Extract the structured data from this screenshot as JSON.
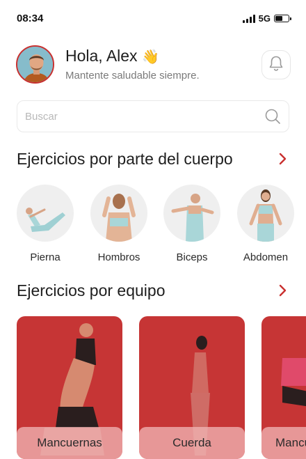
{
  "status_bar": {
    "time": "08:34",
    "network": "5G",
    "battery_level": 0.55
  },
  "header": {
    "greeting": "Hola, Alex",
    "greeting_emoji": "👋",
    "subtitle": "Mantente saludable siempre.",
    "notification_icon": "bell-icon"
  },
  "search": {
    "placeholder": "Buscar",
    "value": "",
    "icon": "search-icon"
  },
  "body_parts_section": {
    "title": "Ejercicios por parte del cuerpo",
    "items": [
      {
        "label": "Pierna"
      },
      {
        "label": "Hombros"
      },
      {
        "label": "Biceps"
      },
      {
        "label": "Abdomen"
      }
    ]
  },
  "equipment_section": {
    "title": "Ejercicios por equipo",
    "items": [
      {
        "label": "Mancuernas"
      },
      {
        "label": "Cuerda"
      },
      {
        "label": "Mancuernas"
      }
    ]
  },
  "colors": {
    "accent": "#c9302f",
    "card_background": "#c63535",
    "circle_background": "#efefef"
  }
}
